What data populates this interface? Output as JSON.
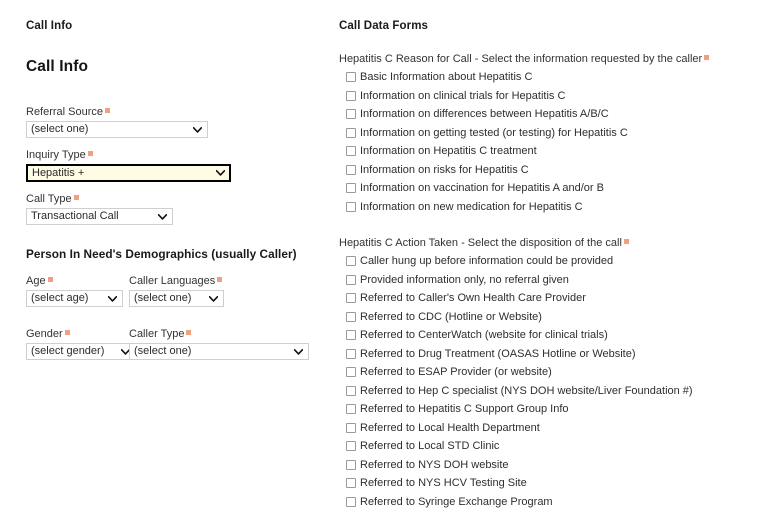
{
  "left": {
    "breadcrumb_title": "Call Info",
    "page_title": "Call Info",
    "fields": [
      {
        "label": "Referral Source",
        "value": "(select one)",
        "required": true,
        "focused": false
      },
      {
        "label": "Inquiry Type",
        "value": "Hepatitis +",
        "required": true,
        "focused": true
      },
      {
        "label": "Call Type",
        "value": "Transactional Call",
        "required": true,
        "focused": false
      }
    ],
    "demographics_title": "Person In Need's Demographics (usually Caller)",
    "demographics": [
      {
        "label": "Age",
        "value": "(select age)",
        "required": true
      },
      {
        "label": "Caller Languages",
        "value": "(select one)",
        "required": true
      },
      {
        "label": "Gender",
        "value": "(select gender)",
        "required": true
      },
      {
        "label": "Caller Type",
        "value": "(select one)",
        "required": true
      }
    ]
  },
  "right": {
    "panel_title": "Call Data Forms",
    "groups": [
      {
        "heading": "Hepatitis C Reason for Call - Select the information requested by the caller",
        "required": true,
        "options": [
          "Basic Information about Hepatitis C",
          "Information on clinical trials for Hepatitis C",
          "Information on differences between Hepatitis A/B/C",
          "Information on getting tested (or testing) for Hepatitis C",
          "Information on Hepatitis C treatment",
          "Information on risks for Hepatitis C",
          "Information on vaccination for Hepatitis A and/or B",
          "Information on new medication for Hepatitis C"
        ]
      },
      {
        "heading": "Hepatitis C Action Taken - Select the disposition of the call",
        "required": true,
        "options": [
          "Caller hung up before information could be provided",
          "Provided information only, no referral given",
          "Referred to Caller's Own Health Care Provider",
          "Referred to CDC (Hotline or Website)",
          "Referred to CenterWatch (website for clinical trials)",
          "Referred to Drug Treatment (OASAS Hotline or Website)",
          "Referred to ESAP Provider (or website)",
          "Referred to Hep C specialist (NYS DOH website/Liver Foundation #)",
          "Referred to Hepatitis C Support Group Info",
          "Referred to Local Health Department",
          "Referred to Local STD Clinic",
          "Referred to NYS DOH website",
          "Referred to NYS HCV Testing Site",
          "Referred to Syringe Exchange Program"
        ]
      }
    ]
  },
  "colors": {
    "required_marker": "#f0a080",
    "focused_select_bg": "#fdfbe4",
    "focused_select_border": "#000000",
    "select_border": "#cfcfcf",
    "text": "#2e2e2e"
  }
}
